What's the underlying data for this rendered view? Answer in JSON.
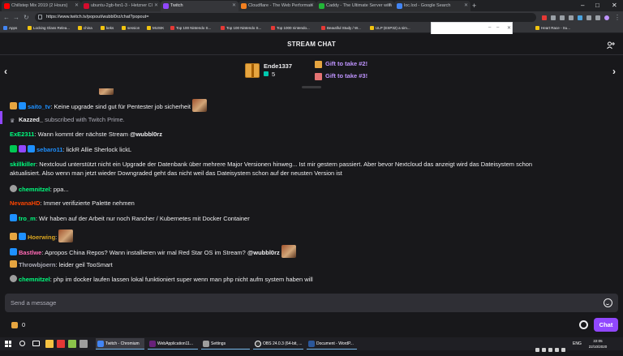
{
  "browser": {
    "tabs": [
      {
        "label": "Chillstep Mix 2019 (2 Hours)",
        "favicon_color": "#ff0000",
        "active": false
      },
      {
        "label": "ubuntu-2gb-fsn1-3 - Hetzner Cl",
        "favicon_color": "#d50c2d",
        "active": false
      },
      {
        "label": "Twitch",
        "favicon_color": "#9147ff",
        "active": true
      },
      {
        "label": "Cloudflare - The Web Performan",
        "favicon_color": "#f38020",
        "active": false
      },
      {
        "label": "Caddy - The Ultimate Server with",
        "favicon_color": "#22b638",
        "active": false
      },
      {
        "label": "loc.lod - Google Search",
        "favicon_color": "#4285f4",
        "active": false
      }
    ],
    "url": "https://www.twitch.tv/popout/wubbl0rz/chat?popout=",
    "bookmarks": [
      "Apps",
      "Locking Glass Relea...",
      "china",
      "keks",
      "session",
      "MUSIK",
      "Top 100 Nintendo S...",
      "Top 100 Nintendo S...",
      "Top 1000 nintendo...",
      "Beautiful Study / W...",
      "ULP (ESP32) a sim...",
      "Heart Race - Su..."
    ]
  },
  "chat": {
    "title": "STREAM CHAT",
    "gift": {
      "user": "Ende1337",
      "count": "5",
      "links": [
        "Gift to take #2!",
        "Gift to take #3!"
      ]
    },
    "messages": [
      {
        "user": "saito_tv",
        "user_color": "#1e90ff",
        "text": ": Keine upgrade sind gut für Pentester job sicherheit"
      },
      {
        "user": "Kazzed_",
        "user_color": "#efeff1",
        "text": " subscribed with Twitch Prime."
      },
      {
        "user": "ExE2311",
        "user_color": "#00ff7f",
        "text": ": Wann kommt der nächste Stream ",
        "mention": "@wubbl0rz"
      },
      {
        "user": "sebaro11",
        "user_color": "#1e90ff",
        "text": ": lickR Allie Sherlock lickL"
      },
      {
        "user": "skillkiller",
        "user_color": "#00ff7f",
        "text": ": Nextcloud unterstützt nicht ein Upgrade der Datenbank über mehrere Major Versionen hinweg... Ist mir gestern passiert. Aber bevor Nextcloud das anzeigt wird das Dateisystem schon",
        "text2": "aktualisiert. Also wenn man jetzt wieder Downgraded geht das nicht weil das Dateisystem schon auf der neusten Version ist"
      },
      {
        "user": "chemnitzel",
        "user_color": "#00ff7f",
        "text": ": ppa..."
      },
      {
        "user": "NevanaHD",
        "user_color": "#ff4500",
        "text": ": Immer verifizierte Palette nehmen"
      },
      {
        "user": "tro_m",
        "user_color": "#00ff7f",
        "text": ": Wir haben auf der Arbeit nur noch Rancher / Kubernetes mit Docker Container"
      },
      {
        "user": "Hoerwing",
        "user_color": "#daa520",
        "text": ":"
      },
      {
        "user": "Bastlwe",
        "user_color": "#ff69b4",
        "text": ": Apropos China Repos? Wann installieren wir mal Red Star OS im Stream? ",
        "mention": "@wubbl0rz"
      },
      {
        "user": "Throwbjoern",
        "user_color": "#adadb8",
        "text": ": leider geil TooSmart"
      },
      {
        "user": "chemnitzel",
        "user_color": "#00ff7f",
        "text": ": php im docker laufen lassen lokal funktioniert super wenn man php nicht aufm system haben will"
      }
    ],
    "input_placeholder": "Send a message",
    "points": "0",
    "chat_button": "Chat"
  },
  "taskbar": {
    "items": [
      "Twitch - Chromium",
      "WebApplication11...",
      "Settings",
      "OBS 24.0.3 (64-bit, ...",
      "Document - WordP..."
    ],
    "lang": "ENG",
    "time": "22:05",
    "date": "22/10/2020"
  }
}
